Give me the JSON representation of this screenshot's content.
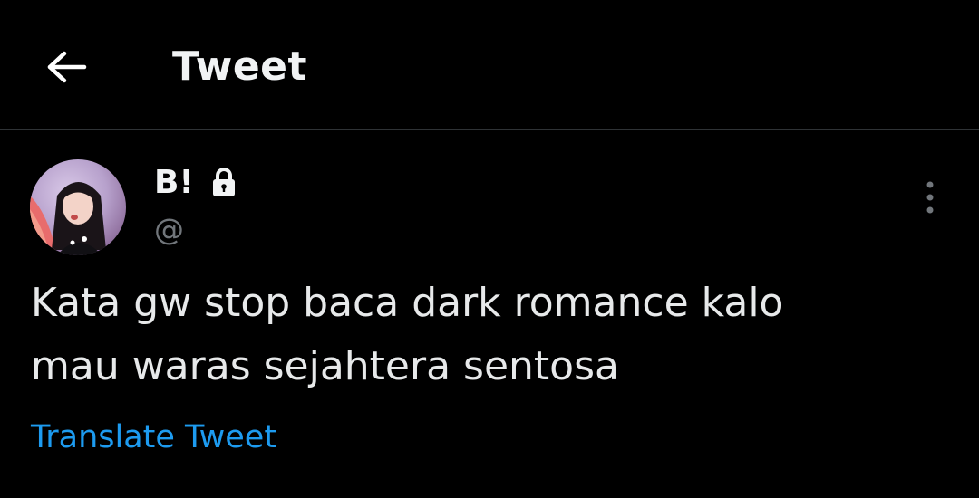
{
  "header": {
    "title": "Tweet",
    "back_icon": "arrow-left-icon"
  },
  "author": {
    "display_name": "B!",
    "handle": "@",
    "protected_icon": "lock-icon",
    "avatar_icon": "profile-photo"
  },
  "tweet": {
    "lines": [
      "Kata gw stop baca dark romance kalo",
      "mau waras sejahtera sentosa"
    ]
  },
  "actions": {
    "translate_label": "Translate Tweet",
    "more_icon": "more-vertical-icon"
  },
  "colors": {
    "background": "#000000",
    "text": "#e7e9ea",
    "muted": "#71767b",
    "link": "#1d9bf0",
    "divider": "#2f3336"
  }
}
